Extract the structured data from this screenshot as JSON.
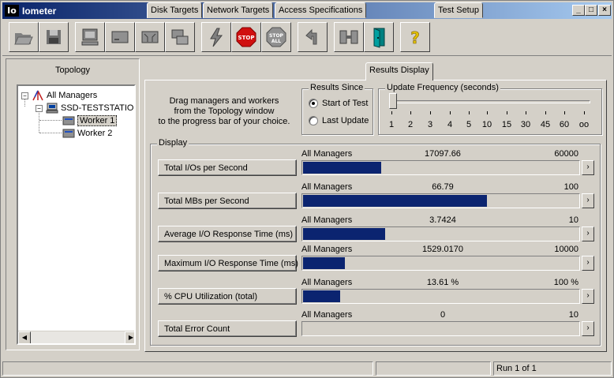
{
  "window": {
    "title": "Iometer",
    "icon_text": "Io"
  },
  "toolbar": {
    "buttons": [
      {
        "name": "open-config-button",
        "icon": "folder-open-icon"
      },
      {
        "name": "save-config-button",
        "icon": "floppy-disk-icon"
      },
      {
        "name": "start-new-manager-button",
        "icon": "computer-icon"
      },
      {
        "name": "start-disk-worker-button",
        "icon": "disk-worker-icon"
      },
      {
        "name": "start-network-worker-button",
        "icon": "network-worker-icon"
      },
      {
        "name": "duplicate-worker-button",
        "icon": "duplicate-icon"
      },
      {
        "name": "start-tests-button",
        "icon": "lightning-icon"
      },
      {
        "name": "stop-button",
        "icon": "stop-sign-icon",
        "label": "STOP"
      },
      {
        "name": "stop-all-button",
        "icon": "stop-all-icon",
        "label": "STOP",
        "sublabel": "ALL"
      },
      {
        "name": "reset-workers-button",
        "icon": "reset-arrow-icon"
      },
      {
        "name": "disconnect-button",
        "icon": "disconnect-icon"
      },
      {
        "name": "exit-button",
        "icon": "exit-door-icon"
      },
      {
        "name": "about-button",
        "icon": "help-icon",
        "label": "?"
      }
    ]
  },
  "topology": {
    "title": "Topology",
    "root": "All Managers",
    "manager": "SSD-TESTSTATIO",
    "workers": [
      "Worker 1",
      "Worker 2"
    ]
  },
  "tabs": [
    "Disk Targets",
    "Network Targets",
    "Access Specifications",
    "Results Display",
    "Test Setup"
  ],
  "active_tab": "Results Display",
  "instructions": [
    "Drag managers and workers",
    "from the Topology window",
    "to the progress bar of your choice."
  ],
  "results_since": {
    "label": "Results Since",
    "options": [
      "Start of Test",
      "Last Update"
    ],
    "selected": "Start of Test"
  },
  "update_frequency": {
    "label": "Update Frequency (seconds)",
    "ticks": [
      "1",
      "2",
      "3",
      "4",
      "5",
      "10",
      "15",
      "30",
      "45",
      "60",
      "oo"
    ],
    "selected": "1"
  },
  "display": {
    "label": "Display",
    "rows": [
      {
        "button": "Total I/Os per Second",
        "source": "All Managers",
        "value": "17097.66",
        "max": "60000",
        "fraction": 0.285
      },
      {
        "button": "Total MBs per Second",
        "source": "All Managers",
        "value": "66.79",
        "max": "100",
        "fraction": 0.668
      },
      {
        "button": "Average I/O Response Time (ms)",
        "source": "All Managers",
        "value": "3.7424",
        "max": "10",
        "fraction": 0.297
      },
      {
        "button": "Maximum I/O Response Time (ms)",
        "source": "All Managers",
        "value": "1529.0170",
        "max": "10000",
        "fraction": 0.153
      },
      {
        "button": "% CPU Utilization (total)",
        "source": "All Managers",
        "value": "13.61 %",
        "max": "100 %",
        "fraction": 0.136
      },
      {
        "button": "Total Error Count",
        "source": "All Managers",
        "value": "0",
        "max": "10",
        "fraction": 0
      }
    ]
  },
  "statusbar": {
    "run": "Run 1 of 1"
  },
  "colors": {
    "bar": "#0b2470",
    "titlebar_start": "#0a246a",
    "titlebar_end": "#a6caf0",
    "face": "#d4d0c8"
  }
}
